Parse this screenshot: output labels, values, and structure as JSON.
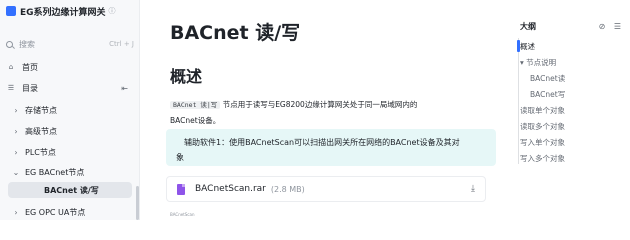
{
  "sidebar": {
    "title": "EG系列边缘计算网关",
    "title_info_icon": "ⓘ",
    "search": {
      "placeholder": "搜索",
      "shortcut": "Ctrl + J"
    },
    "items": [
      {
        "label": "首页",
        "icon": "home-icon"
      },
      {
        "label": "目录",
        "icon": "menu-icon"
      },
      {
        "label": "存储节点",
        "expandable": true
      },
      {
        "label": "高级节点",
        "expandable": true
      },
      {
        "label": "PLC节点",
        "expandable": true
      },
      {
        "label": "EG BACnet节点",
        "expanded": true
      },
      {
        "label": "BACnet 读/写",
        "active": true
      },
      {
        "label": "EG OPC UA节点",
        "expandable": true
      }
    ]
  },
  "main": {
    "title": "BACnet 读/写",
    "section_heading": "概述",
    "intro_code": "BACnet 读|写",
    "intro_line1": " 节点用于读写与EG8200边缘计算网关处于同一局域网内的",
    "intro_line2": "BACnet设备。",
    "callout_line1": "辅助软件1：使用BACnetScan可以扫描出网关所在网络的BACnet设备及其对",
    "callout_line2": "象",
    "attachment": {
      "name": "BACnetScan.rar",
      "size": "(2.8 MB)",
      "icon": "file-archive-icon"
    },
    "caption": "BACnetScan"
  },
  "outline": {
    "heading": "大纲",
    "tools": "⊘ ☰",
    "items": [
      {
        "label": "概述",
        "level": 1,
        "active": true
      },
      {
        "label": "▾ 节点说明",
        "level": 1
      },
      {
        "label": "BACnet读",
        "level": 2
      },
      {
        "label": "BACnet写",
        "level": 2
      },
      {
        "label": "读取单个对象",
        "level": 1
      },
      {
        "label": "读取多个对象",
        "level": 1
      },
      {
        "label": "写入单个对象",
        "level": 1
      },
      {
        "label": "写入多个对象",
        "level": 1
      }
    ]
  },
  "colors": {
    "accent": "#3370ff",
    "callout_bg": "#e6f7f7",
    "sidebar_bg": "#f7f8fa"
  }
}
